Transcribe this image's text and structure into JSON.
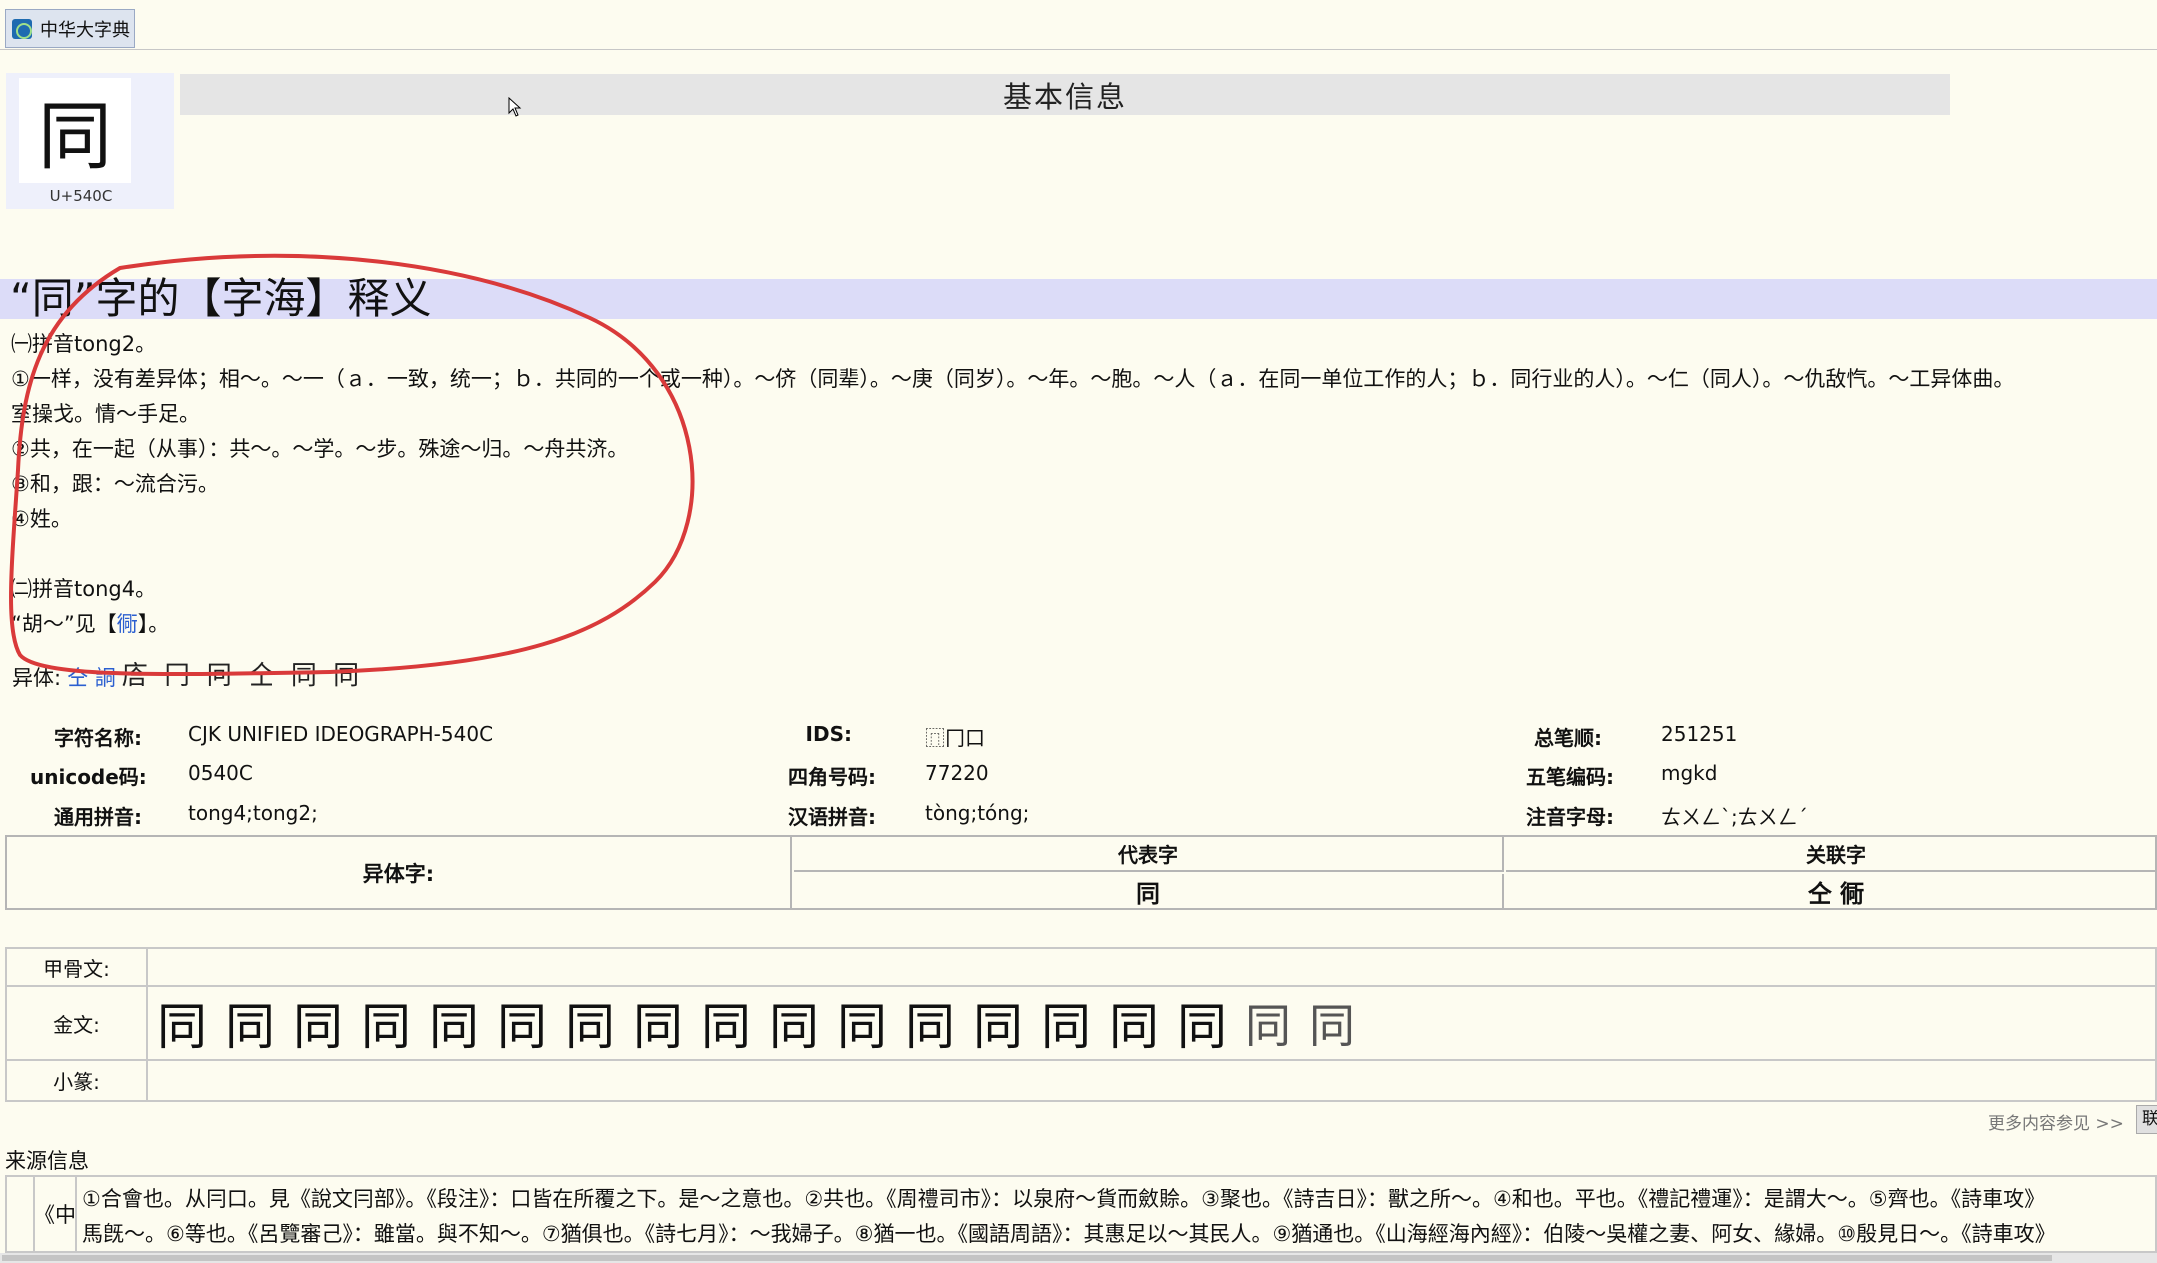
{
  "window": {
    "tab_title": "中华大字典"
  },
  "character": {
    "glyph": "同",
    "codepoint": "U+540C"
  },
  "basic_info": {
    "header": "基本信息"
  },
  "zihai": {
    "title": "“同”字的【字海】释义",
    "lines": [
      "㈠拼音tong2。",
      "①一样，没有差异体；相～。～一（ａ．一致，统一；ｂ．共同的一个或一种）。～侪（同辈）。～庚（同岁）。～年。～胞。～人（ａ．在同一单位工作的人；ｂ．同行业的人）。～仁（同人）。～仇敌忾。～工异体曲。",
      "室操戈。情～手足。",
      "②共，在一起（从事）：共～。～学。～步。殊途～归。～舟共济。",
      "③和，跟：～流合污。",
      "④姓。",
      "㈡拼音tong4。"
    ],
    "see_prefix": "“胡～”见【",
    "see_link": "衕",
    "see_suffix": "】。"
  },
  "variants_line": {
    "label": "异体:",
    "links": "仝 詷",
    "glyphs": "𢈈 冂 冋 仝 同 同"
  },
  "info": {
    "char_name_label": "字符名称:",
    "char_name": "CJK UNIFIED IDEOGRAPH-540C",
    "ids_label": "IDS:",
    "ids": "⿵冂口",
    "strokes_label": "总笔顺:",
    "strokes": "251251",
    "unicode_label": "unicode码:",
    "unicode": "0540C",
    "sijiao_label": "四角号码:",
    "sijiao": "77220",
    "wubi_label": "五笔编码:",
    "wubi": "mgkd",
    "tongyong_label": "通用拼音:",
    "tongyong": "tong4;tong2;",
    "hanyu_label": "汉语拼音:",
    "hanyu": "tòng;tóng;",
    "zhuyin_label": "注音字母:",
    "zhuyin": "ㄊㄨㄥˋ;ㄊㄨㄥˊ"
  },
  "variant_table": {
    "row_label": "异体字:",
    "rep_header": "代表字",
    "rep_value": "同",
    "rel_header": "关联字",
    "rel_value": "仝 衕"
  },
  "ancient": {
    "oracle_label": "甲骨文:",
    "bronze_label": "金文:",
    "bronze_glyphs": [
      "同",
      "同",
      "同",
      "同",
      "同",
      "同",
      "同",
      "同",
      "同",
      "同",
      "同",
      "同",
      "同",
      "同",
      "同",
      "同",
      "同",
      "同"
    ],
    "seal_label": "小篆:"
  },
  "more": {
    "text": "更多内容参见 >>",
    "button": "联"
  },
  "source": {
    "title": "来源信息",
    "book_label": "《中",
    "line1": "①合會也。从冃口。見《說文冃部》。《段注》：口皆在所覆之下。是～之意也。②共也。《周禮司市》：以泉府～貨而斂賒。③聚也。《詩吉日》：獸之所～。④和也。平也。《禮記禮運》：是謂大～。⑤齊也。《詩車攻》",
    "line2": "馬旣～。⑥等也。《呂覽審己》：雖當。與不知～。⑦猶俱也。《詩七月》：～我婦子。⑧猶一也。《國語周語》：其惠足以～其民人。⑨猶通也。《山海經海內經》：伯陵～吳權之妻、阿女、緣婦。⑩殷見日～。《詩車攻》"
  }
}
